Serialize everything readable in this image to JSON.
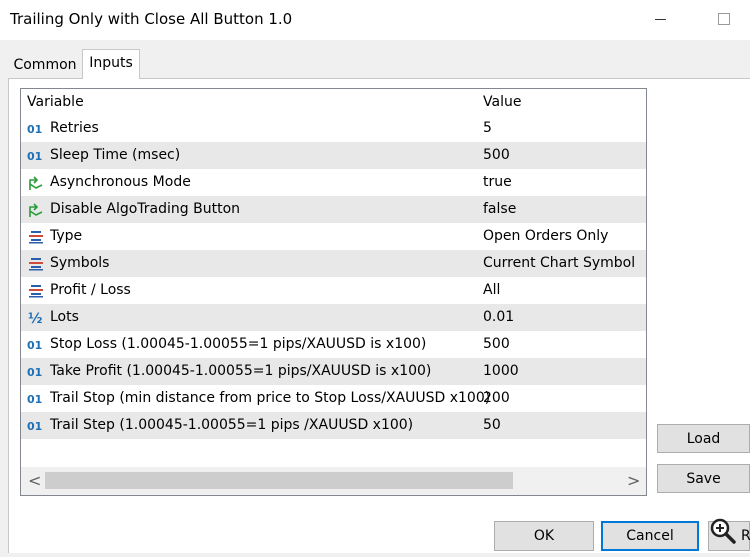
{
  "window": {
    "title": "Trailing Only with Close All Button 1.0"
  },
  "tabs": {
    "common": "Common",
    "inputs": "Inputs"
  },
  "grid": {
    "header": {
      "variable": "Variable",
      "value": "Value"
    },
    "rows": [
      {
        "icon": "int-01-icon",
        "name": "Retries",
        "value": "5"
      },
      {
        "icon": "int-01-icon",
        "name": "Sleep Time (msec)",
        "value": "500"
      },
      {
        "icon": "bool-arrow-icon",
        "name": "Asynchronous Mode",
        "value": "true"
      },
      {
        "icon": "bool-arrow-icon",
        "name": "Disable AlgoTrading Button",
        "value": "false"
      },
      {
        "icon": "enum-list-icon",
        "name": "Type",
        "value": "Open Orders Only"
      },
      {
        "icon": "enum-list-icon",
        "name": "Symbols",
        "value": "Current Chart Symbol"
      },
      {
        "icon": "enum-list-icon",
        "name": "Profit / Loss",
        "value": "All"
      },
      {
        "icon": "double-half-icon",
        "name": "Lots",
        "value": "0.01"
      },
      {
        "icon": "int-01-icon",
        "name": "Stop Loss (1.00045-1.00055=1 pips/XAUUSD is x100)",
        "value": "500"
      },
      {
        "icon": "int-01-icon",
        "name": "Take Profit (1.00045-1.00055=1 pips/XAUUSD is x100)",
        "value": "1000"
      },
      {
        "icon": "int-01-icon",
        "name": "Trail Stop (min distance from price to Stop Loss/XAUUSD x100)",
        "value": "200"
      },
      {
        "icon": "int-01-icon",
        "name": "Trail Step (1.00045-1.00055=1 pips /XAUUSD x100)",
        "value": "50"
      }
    ]
  },
  "icons": {
    "int": "01",
    "double": "½"
  },
  "scrollbar": {
    "left": "<",
    "right": ">"
  },
  "buttons": {
    "load": "Load",
    "save": "Save",
    "ok": "OK",
    "cancel": "Cancel",
    "reset": "R"
  },
  "colors": {
    "int_icon": "#1f6fb5",
    "bool_icon": "#2a9d3a",
    "enum_icon": "#2b5fad",
    "focus": "#0078d7"
  }
}
